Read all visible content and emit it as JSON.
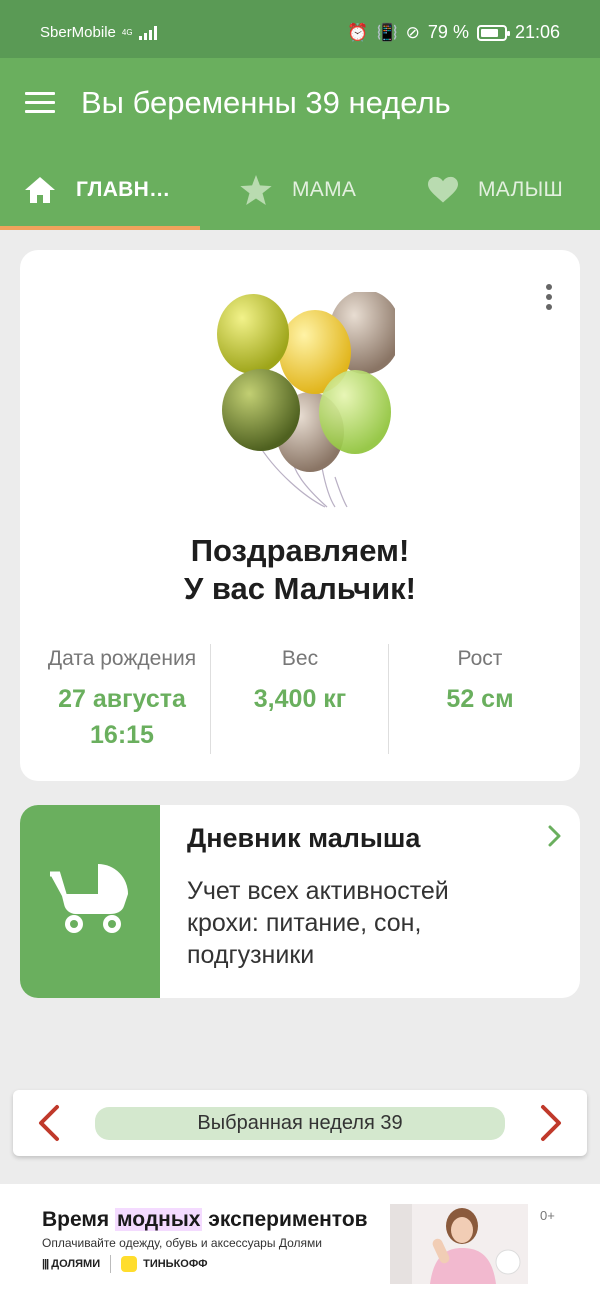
{
  "status_bar": {
    "carrier": "SberMobile",
    "network": "4G",
    "battery_percent": "79 %",
    "battery_level": 0.79,
    "time": "21:06"
  },
  "app_bar": {
    "title": "Вы беременны 39 недель",
    "menu_icon": "hamburger-menu-icon"
  },
  "tabs": [
    {
      "label": "ГЛАВН…",
      "icon": "home-icon",
      "active": true
    },
    {
      "label": "МАМА",
      "icon": "star-icon",
      "active": false
    },
    {
      "label": "МАЛЫШ",
      "icon": "heart-icon",
      "active": false
    }
  ],
  "birth_card": {
    "image": "balloons-illustration",
    "congrats_line1": "Поздравляем!",
    "congrats_line2": "У вас Мальчик!",
    "stats": [
      {
        "label": "Дата рождения",
        "value_line1": "27 августа",
        "value_line2": "16:15"
      },
      {
        "label": "Вес",
        "value_line1": "3,400 кг"
      },
      {
        "label": "Рост",
        "value_line1": "52 см"
      }
    ]
  },
  "diary_card": {
    "icon": "baby-stroller-icon",
    "title": "Дневник малыша",
    "description": "Учет всех активностей крохи: питание, сон, подгузники"
  },
  "week_nav": {
    "label": "Выбранная неделя 39"
  },
  "ad_banner": {
    "title_before": "Время ",
    "title_highlight": "модных",
    "title_after": " экспериментов",
    "subtitle": "Оплачивайте одежду, обувь и аксессуары Долями",
    "brand1": "ДОЛЯМИ",
    "brand2": "ТИНЬКОФФ",
    "age_rating": "0+"
  },
  "colors": {
    "status_bar": "#5a9a55",
    "primary": "#6aaf5e",
    "tab_indicator": "#f0a35c",
    "chevron_red": "#c0392b",
    "background": "#ececec"
  }
}
